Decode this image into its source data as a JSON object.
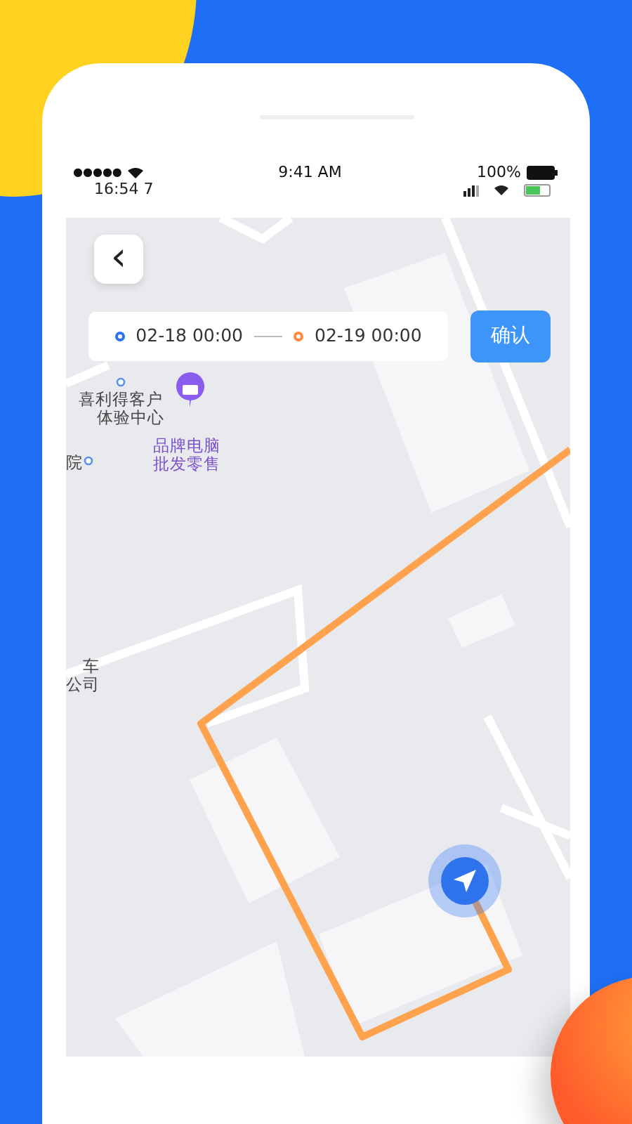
{
  "status_bar": {
    "signal": "●●●●●",
    "time": "9:41 AM",
    "battery": "100%"
  },
  "app_status_bar": {
    "time": "16:54 7"
  },
  "back_button": {
    "label": "‹"
  },
  "date_range": {
    "start": "02-18 00:00",
    "end": "02-19 00:00"
  },
  "confirm_button": {
    "label": "确认"
  },
  "map": {
    "labels": [
      {
        "kind": "place",
        "text": "喜利得客户"
      },
      {
        "kind": "place",
        "text": "体验中心"
      },
      {
        "kind": "shop",
        "text": "品牌电脑"
      },
      {
        "kind": "edge",
        "text": "院"
      },
      {
        "kind": "shop",
        "text": "批发零售"
      },
      {
        "kind": "edge",
        "text": "车"
      },
      {
        "kind": "edge",
        "text": "公司"
      }
    ]
  }
}
